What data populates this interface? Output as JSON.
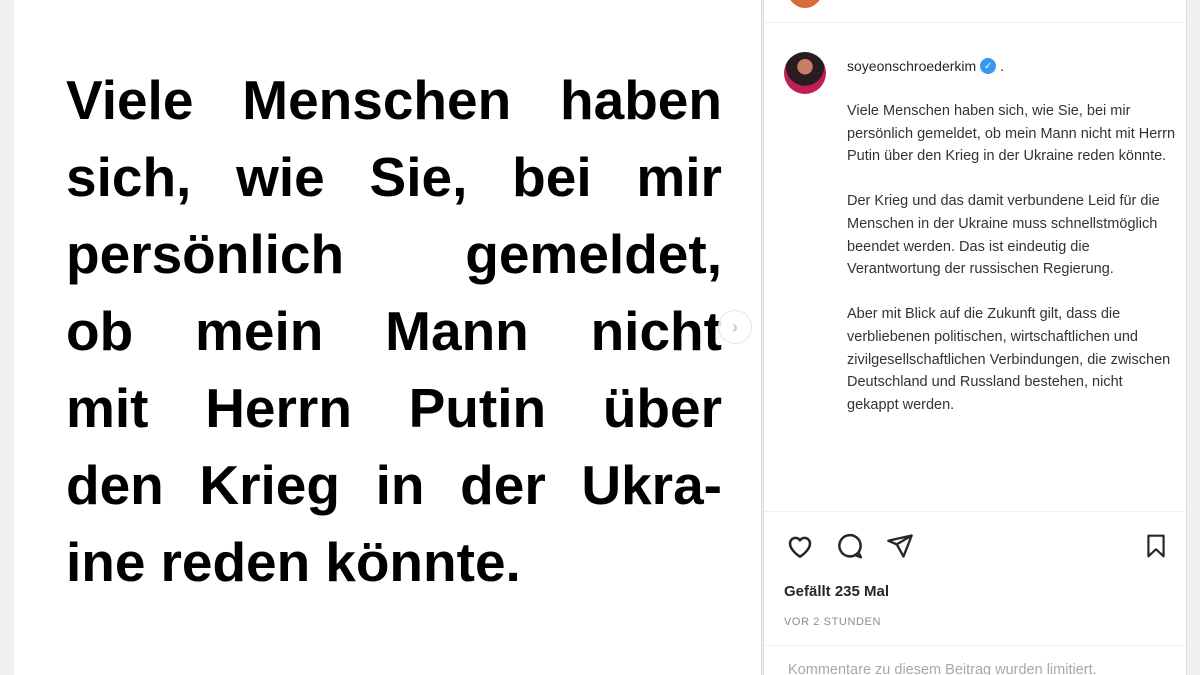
{
  "post": {
    "lines": [
      [
        "Viele",
        "Menschen",
        "haben"
      ],
      [
        "sich,",
        "wie",
        "Sie,",
        "bei",
        "mir"
      ],
      [
        "persönlich",
        "gemeldet,"
      ],
      [
        "ob",
        "mein",
        "Mann",
        "nicht"
      ],
      [
        "mit",
        "Herrn",
        "Putin",
        "über"
      ],
      [
        "den",
        "Krieg",
        "in",
        "der",
        "Ukra-"
      ],
      [
        "ine",
        "reden",
        "könnte."
      ]
    ],
    "next_arrow": "›"
  },
  "caption": {
    "username": "soyeonschroederkim",
    "verified_mark": "✓",
    "suffix": ".",
    "paragraphs": [
      "Viele Menschen haben sich, wie Sie, bei mir persönlich gemeldet, ob mein Mann nicht mit Herrn Putin über den Krieg in der Ukraine reden könnte.",
      "Der Krieg und das damit verbundene Leid für die Menschen in der Ukraine muss schnellstmöglich beendet werden. Das ist eindeutig die Verantwortung der russischen Regierung.",
      "Aber mit Blick auf die Zukunft gilt, dass die verbliebenen politischen, wirtschaftlichen und zivilgesellschaftlichen Verbindungen, die zwischen Deutschland und Russland bestehen, nicht gekappt werden."
    ]
  },
  "actions": {
    "icons": [
      "heart-icon",
      "comment-icon",
      "share-icon",
      "bookmark-icon"
    ]
  },
  "likes_text": "Gefällt 235 Mal",
  "time_text": "VOR 2 STUNDEN",
  "comments_note": "Kommentare zu diesem Beitrag wurden limitiert."
}
